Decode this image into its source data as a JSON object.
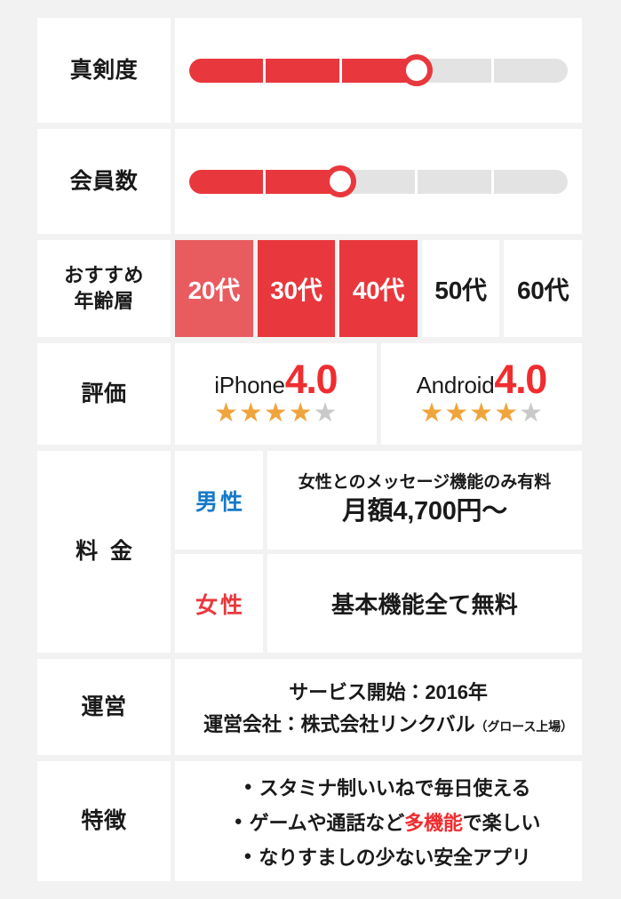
{
  "theme": {
    "accent_red": "#e8383d",
    "accent_red_soft": "#e85c60",
    "score_red": "#ef2d30",
    "male_blue": "#1579c8",
    "star_orange": "#efa53c",
    "star_gray": "#c9c9c9",
    "page_background": "#f2f2f2",
    "cell_background": "#ffffff",
    "track_gray": "#e3e3e3"
  },
  "rows": {
    "seriousness": {
      "label": "真剣度",
      "segments_total": 5,
      "segments_filled": 3
    },
    "members": {
      "label": "会員数",
      "segments_total": 5,
      "segments_filled": 2
    },
    "age": {
      "label_line1": "おすすめ",
      "label_line2": "年齢層",
      "cells": [
        {
          "text": "20代",
          "state": "soft"
        },
        {
          "text": "30代",
          "state": "strong"
        },
        {
          "text": "40代",
          "state": "strong"
        },
        {
          "text": "50代",
          "state": "off"
        },
        {
          "text": "60代",
          "state": "off"
        }
      ]
    },
    "rating": {
      "label": "評価",
      "items": [
        {
          "platform": "iPhone",
          "score": "4.0",
          "stars_filled": 4,
          "stars_total": 5
        },
        {
          "platform": "Android",
          "score": "4.0",
          "stars_filled": 4,
          "stars_total": 5
        }
      ]
    },
    "fee": {
      "label": "料金",
      "male": {
        "gender": "男性",
        "note": "女性とのメッセージ機能のみ有料",
        "amount": "月額4,700円〜"
      },
      "female": {
        "gender": "女性",
        "detail": "基本機能全て無料"
      }
    },
    "operator": {
      "label": "運営",
      "service_start": "サービス開始：2016年",
      "company": "運営会社：株式会社リンクバル",
      "company_note": "（グロース上場）"
    },
    "features": {
      "label": "特徴",
      "bullet_glyph": "●",
      "items": [
        {
          "before": "スタミナ制いいねで毎日使える",
          "accent": "",
          "after": ""
        },
        {
          "before": "ゲームや通話など",
          "accent": "多機能",
          "after": "で楽しい"
        },
        {
          "before": "なりすましの少ない安全アプリ",
          "accent": "",
          "after": ""
        }
      ]
    }
  }
}
